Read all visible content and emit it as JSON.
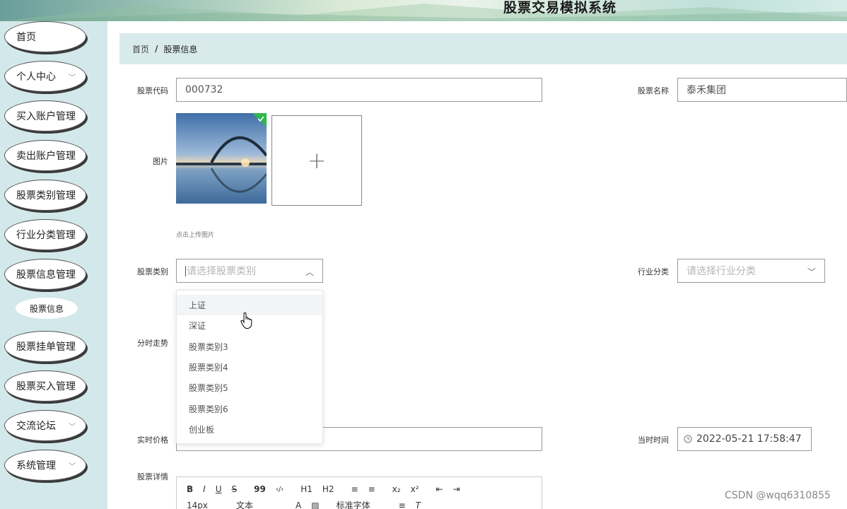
{
  "app": {
    "title": "股票交易模拟系统"
  },
  "sidebar": {
    "items": [
      {
        "label": "首页",
        "chevron": false
      },
      {
        "label": "个人中心",
        "chevron": true
      },
      {
        "label": "买入账户管理",
        "chevron": false
      },
      {
        "label": "卖出账户管理",
        "chevron": false
      },
      {
        "label": "股票类别管理",
        "chevron": false
      },
      {
        "label": "行业分类管理",
        "chevron": false
      },
      {
        "label": "股票信息管理",
        "chevron": false
      },
      {
        "label": "股票挂单管理",
        "chevron": false
      },
      {
        "label": "股票买入管理",
        "chevron": false
      },
      {
        "label": "交流论坛",
        "chevron": true
      },
      {
        "label": "系统管理",
        "chevron": true
      }
    ],
    "sub_item": {
      "label": "股票信息"
    }
  },
  "breadcrumb": {
    "home": "首页",
    "separator": "/",
    "current": "股票信息"
  },
  "form": {
    "stock_code": {
      "label": "股票代码",
      "value": "000732"
    },
    "stock_name": {
      "label": "股票名称",
      "value": "泰禾集团"
    },
    "image": {
      "label": "图片",
      "hint": "点击上传图片",
      "upload_symbol": "+"
    },
    "stock_category": {
      "label": "股票类别",
      "placeholder": "请选择股票类别"
    },
    "industry": {
      "label": "行业分类",
      "placeholder": "请选择行业分类"
    },
    "trend": {
      "label": "分时走势"
    },
    "price": {
      "label": "实时价格",
      "value": ""
    },
    "current_time": {
      "label": "当时时间",
      "value": "2022-05-21 17:58:47"
    },
    "detail": {
      "label": "股票详情"
    }
  },
  "dropdown": {
    "options": [
      "上证",
      "深证",
      "股票类别3",
      "股票类别4",
      "股票类别5",
      "股票类别6",
      "创业板"
    ]
  },
  "editor_toolbar": {
    "row1": [
      "B",
      "I",
      "U",
      "S",
      "99",
      "‹/›",
      "H1",
      "H2",
      "≡",
      "≡",
      "x₂",
      "x²",
      "⇤",
      "⇥"
    ],
    "font_size": "14px",
    "block_type": "文本",
    "font_family": "标准字体"
  },
  "watermark": "CSDN @wqq6310855"
}
